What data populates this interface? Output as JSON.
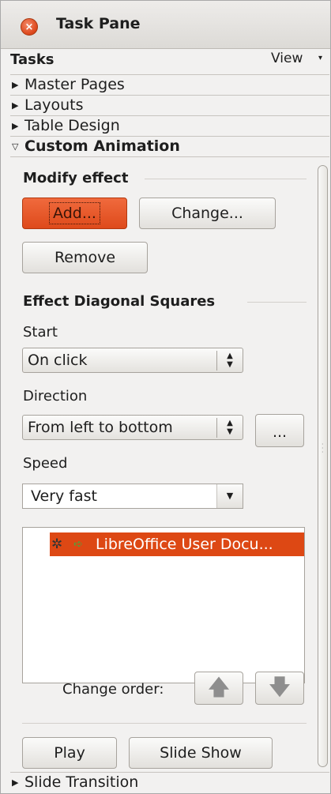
{
  "window": {
    "title": "Task Pane",
    "close_glyph": "×"
  },
  "tasks": {
    "label": "Tasks",
    "view_label": "View",
    "view_arrow": "▾"
  },
  "decks": [
    {
      "label": "Master Pages",
      "expanded": false
    },
    {
      "label": "Layouts",
      "expanded": false
    },
    {
      "label": "Table Design",
      "expanded": false
    },
    {
      "label": "Custom Animation",
      "expanded": true
    },
    {
      "label": "Slide Transition",
      "expanded": false
    }
  ],
  "glyphs": {
    "collapsed": "▶",
    "expanded": "▽",
    "spin": "▲\n▼",
    "dropdown": "▼",
    "up_arrow": "🡅",
    "down_arrow": "🡇"
  },
  "custom_animation": {
    "modify_effect_title": "Modify effect",
    "add_label": "Add...",
    "change_label": "Change...",
    "remove_label": "Remove",
    "effect_title": "Effect Diagonal Squares",
    "start_label": "Start",
    "start_value": "On click",
    "direction_label": "Direction",
    "direction_value": "From left to bottom",
    "options_label": "...",
    "speed_label": "Speed",
    "speed_value": "Very fast",
    "effects": [
      {
        "text": "LibreOffice User Docu...",
        "selected": true
      }
    ],
    "change_order_label": "Change order:",
    "play_label": "Play",
    "slideshow_label": "Slide Show"
  },
  "colors": {
    "accent": "#dd4814",
    "selection": "#dd4814",
    "panel_bg": "#f2f1f0"
  }
}
